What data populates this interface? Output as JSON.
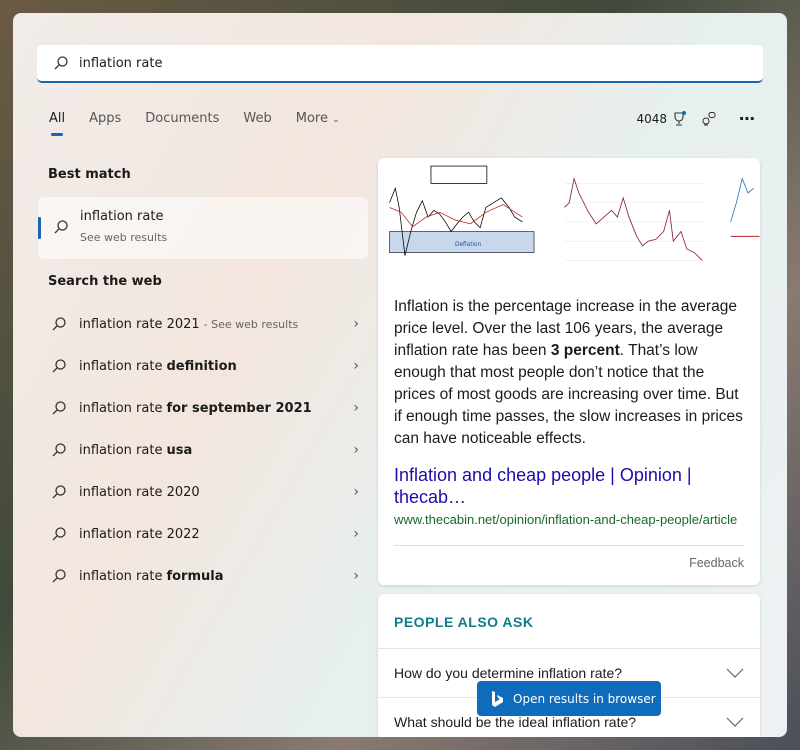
{
  "search": {
    "query": "inflation rate"
  },
  "tabs": [
    {
      "label": "All"
    },
    {
      "label": "Apps"
    },
    {
      "label": "Documents"
    },
    {
      "label": "Web"
    },
    {
      "label": "More"
    }
  ],
  "toolbar": {
    "points": "4048",
    "icons": [
      "trophy-icon",
      "share-icon",
      "more-icon"
    ]
  },
  "best_match": {
    "heading": "Best match",
    "title": "inflation rate",
    "subtitle": "See web results"
  },
  "search_web": {
    "heading": "Search the web",
    "items": [
      {
        "prefix": "inflation rate 2021",
        "bold": "",
        "note": "- See web results"
      },
      {
        "prefix": "inflation rate",
        "bold": "definition",
        "note": ""
      },
      {
        "prefix": "inflation rate",
        "bold": "for september 2021",
        "note": ""
      },
      {
        "prefix": "inflation rate",
        "bold": "usa",
        "note": ""
      },
      {
        "prefix": "inflation rate 2020",
        "bold": "",
        "note": ""
      },
      {
        "prefix": "inflation rate 2022",
        "bold": "",
        "note": ""
      },
      {
        "prefix": "inflation rate",
        "bold": "formula",
        "note": ""
      }
    ]
  },
  "answer": {
    "text_before": "Inflation is the percentage increase in the average price level. Over the last 106 years, the average inflation rate has been ",
    "text_bold": "3 percent",
    "text_after": ". That’s low enough that most people don’t notice that the prices of most goods are increasing over time. But if enough time passes, the slow increases in prices can have noticeable effects.",
    "link_title": "Inflation and cheap people | Opinion | thecab…",
    "url": "www.thecabin.net/opinion/inflation-and-cheap-people/article",
    "feedback": "Feedback",
    "thumb1_label": "Deflation"
  },
  "people_also_ask": {
    "heading": "PEOPLE ALSO ASK",
    "questions": [
      "How do you determine inflation rate?",
      "What should be the ideal inflation rate?"
    ]
  },
  "open_browser": {
    "label": "Open results in browser"
  },
  "colors": {
    "accent": "#1a64b4",
    "link": "#1a0dab",
    "url": "#166a2c",
    "paa": "#127a8a",
    "button": "#0f6cbd"
  }
}
